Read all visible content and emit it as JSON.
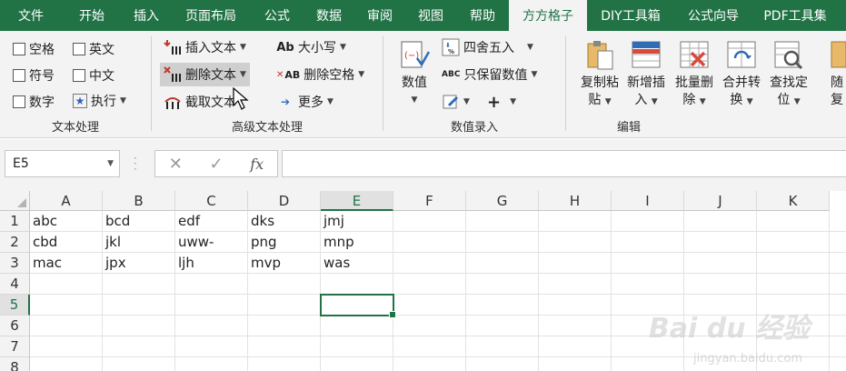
{
  "menu": {
    "tabs": [
      "文件",
      "开始",
      "插入",
      "页面布局",
      "公式",
      "数据",
      "审阅",
      "视图",
      "帮助",
      "方方格子",
      "DIY工具箱",
      "公式向导",
      "PDF工具集"
    ],
    "active_index": 9
  },
  "ribbon": {
    "text_group": {
      "label": "文本处理",
      "checkboxes": [
        "空格",
        "英文",
        "符号",
        "中文",
        "数字"
      ],
      "execute_label": "执行"
    },
    "advanced_group": {
      "label": "高级文本处理",
      "insert_text": "插入文本",
      "delete_text": "删除文本",
      "extract_text": "截取文本",
      "case": "大小写",
      "delete_space": "删除空格",
      "more": "更多",
      "case_icon": "Ab",
      "delete_space_icon": "AB"
    },
    "number_group": {
      "label": "数值录入",
      "value_label": "数值",
      "round": "四舍五入",
      "keep_value": "只保留数值",
      "keep_value_icon": "ABC",
      "plus": "+"
    },
    "edit_group": {
      "label": "编辑",
      "copy_paste": [
        "复制粘",
        "贴"
      ],
      "add_insert": [
        "新增插",
        "入"
      ],
      "batch_delete": [
        "批量删",
        "除"
      ],
      "merge_convert": [
        "合并转",
        "换"
      ],
      "find_locate": [
        "查找定",
        "位"
      ],
      "random_partial": [
        "随",
        "复"
      ]
    }
  },
  "formula_bar": {
    "name_box": "E5",
    "cancel": "✕",
    "confirm": "✓",
    "fx": "fx",
    "value": ""
  },
  "sheet": {
    "columns": [
      "A",
      "B",
      "C",
      "D",
      "E",
      "F",
      "G",
      "H",
      "I",
      "J",
      "K"
    ],
    "rows": [
      "1",
      "2",
      "3",
      "4",
      "5",
      "6",
      "7",
      "8"
    ],
    "selected_column": "E",
    "selected_row": "5",
    "cells": [
      [
        "abc",
        "bcd",
        "edf",
        "dks",
        "jmj"
      ],
      [
        "cbd",
        "jkl",
        "uww-",
        "png",
        "mnp"
      ],
      [
        "mac",
        "jpx",
        "ljh",
        "mvp",
        "was"
      ]
    ]
  },
  "watermark": {
    "brand": "Bai du 经验",
    "url": "jingyan.baidu.com"
  },
  "colors": {
    "accent": "#217346",
    "ribbon_bg": "#f3f3f3",
    "red_icon": "#c0392b"
  }
}
